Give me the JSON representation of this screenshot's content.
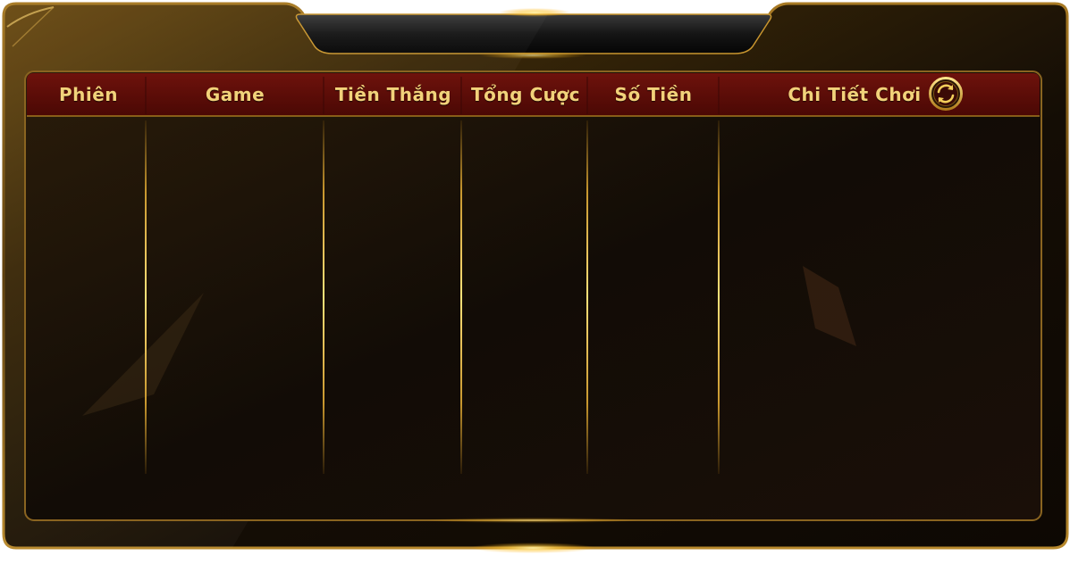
{
  "history_table": {
    "columns": [
      {
        "label": "Phiên"
      },
      {
        "label": "Game"
      },
      {
        "label": "Tiền Thắng"
      },
      {
        "label": "Tổng Cược"
      },
      {
        "label": "Số Tiền"
      },
      {
        "label": "Chi Tiết Chơi"
      }
    ],
    "rows": []
  },
  "icons": {
    "refresh": "refresh-icon"
  },
  "colors": {
    "header_red": "#5a0a06",
    "gold": "#f2d27a",
    "panel": "#1a120a"
  }
}
